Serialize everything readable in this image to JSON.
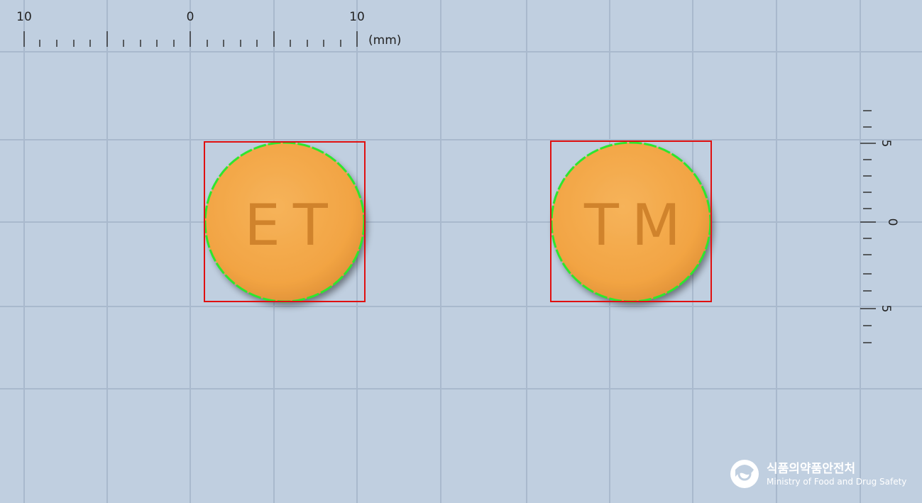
{
  "ruler_top": {
    "labels": [
      "10",
      "0",
      "10"
    ],
    "unit": "(mm)"
  },
  "ruler_right": {
    "labels": [
      "5",
      "0",
      "5"
    ]
  },
  "pills": [
    {
      "imprint": "ET",
      "color": "#f4a84a"
    },
    {
      "imprint": "TM",
      "color": "#f4a84a"
    }
  ],
  "logo": {
    "korean": "식품의약품안전처",
    "english": "Ministry of Food and Drug Safety"
  },
  "colors": {
    "background": "#c0cfe0",
    "grid_line": "#a7b8cc",
    "bounding_box": "#e01010",
    "contour": "#2ee62e",
    "pill": "#f4a84a"
  }
}
